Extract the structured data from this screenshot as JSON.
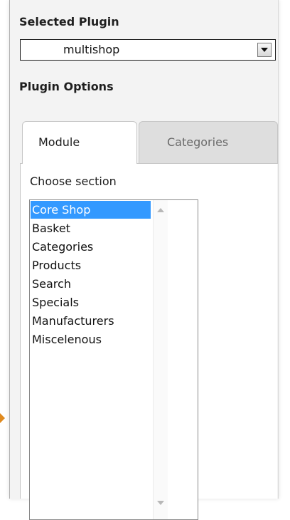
{
  "plugin": {
    "title": "Selected Plugin",
    "selected_value": "multishop"
  },
  "options": {
    "title": "Plugin Options",
    "tabs": [
      {
        "label": "Module",
        "active": true
      },
      {
        "label": "Categories",
        "active": false
      }
    ]
  },
  "section": {
    "label": "Choose section",
    "items": [
      {
        "label": "Core Shop",
        "selected": true
      },
      {
        "label": "Basket",
        "selected": false
      },
      {
        "label": "Categories",
        "selected": false
      },
      {
        "label": "Products",
        "selected": false
      },
      {
        "label": "Search",
        "selected": false
      },
      {
        "label": "Specials",
        "selected": false
      },
      {
        "label": "Manufacturers",
        "selected": false
      },
      {
        "label": "Miscelenous",
        "selected": false
      }
    ]
  },
  "colors": {
    "selection": "#3399ff",
    "panel_bg": "#f3f3f3",
    "side_arrow": "#e08a1e"
  },
  "icons": {
    "dropdown": "chevron-down-icon",
    "scroll_up": "triangle-up-icon",
    "scroll_down": "triangle-down-icon",
    "side_marker": "triangle-right-icon"
  }
}
